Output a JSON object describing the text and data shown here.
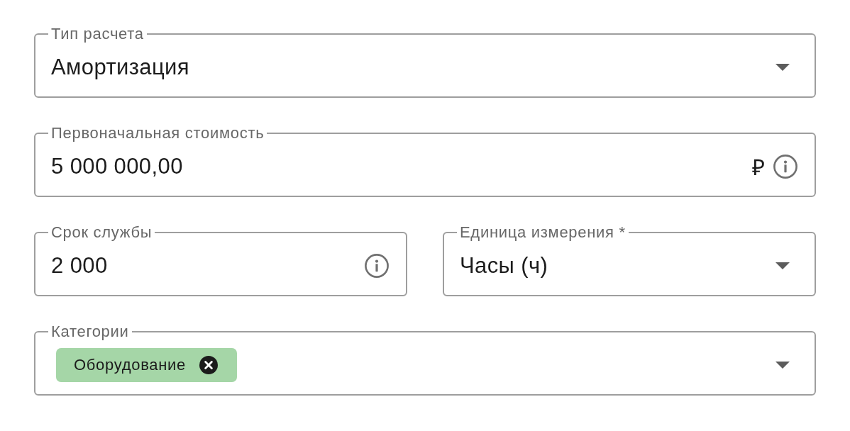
{
  "rows": [
    {
      "fields": [
        {
          "kind": "select",
          "label": "Тип расчета",
          "value": "Амортизация",
          "info": false
        }
      ]
    },
    {
      "fields": [
        {
          "kind": "input",
          "label": "Первоначальная стоимость",
          "value": "5 000 000,00",
          "suffix": "₽",
          "info": true
        }
      ]
    },
    {
      "fields": [
        {
          "kind": "input",
          "label": "Срок службы",
          "value": "2 000",
          "info": true
        },
        {
          "kind": "select",
          "label": "Единица измерения *",
          "value": "Часы (ч)",
          "info": false
        }
      ]
    },
    {
      "fields": [
        {
          "kind": "multiselect",
          "label": "Категории",
          "chips": [
            {
              "label": "Оборудование"
            }
          ],
          "info": false
        }
      ]
    }
  ]
}
